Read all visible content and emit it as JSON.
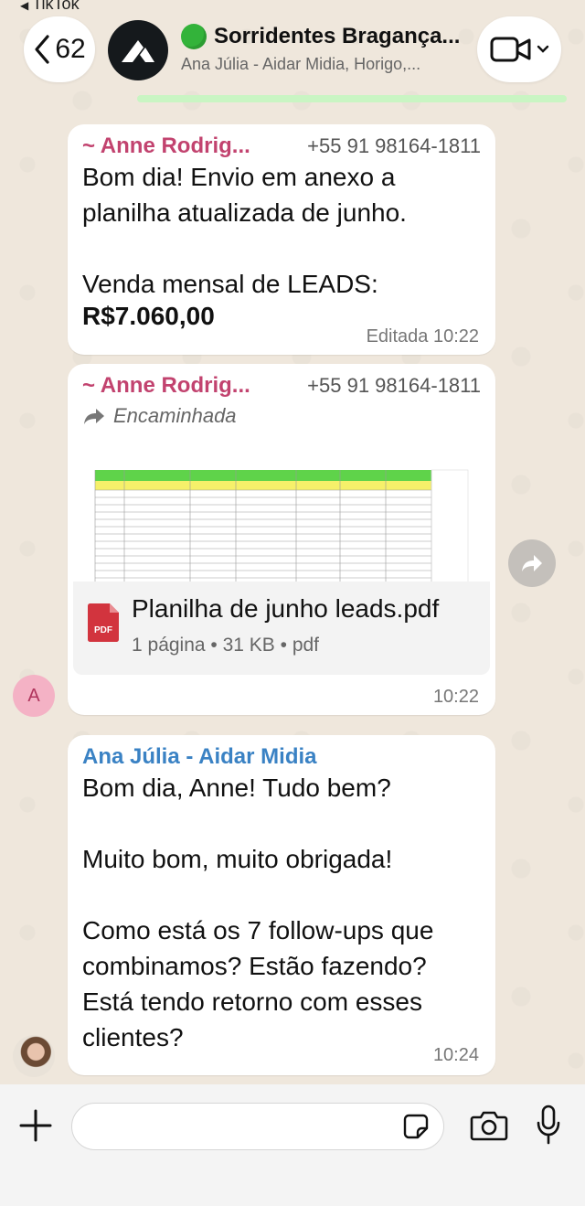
{
  "status": {
    "back_app": "TikTok"
  },
  "header": {
    "back_count": "62",
    "group_name": "Sorridentes Bragança...",
    "participants": "Ana Júlia - Aidar Midia, Horigo,..."
  },
  "messages": [
    {
      "sender": "~ Anne Rodrig...",
      "phone": "+55 91 98164-1811",
      "text": "Bom dia! Envio em anexo a\nplanilha atualizada de junho.\n\nVenda mensal de LEADS:",
      "bold": "R$7.060,00",
      "time": "Editada 10:22"
    },
    {
      "sender": "~ Anne Rodrig...",
      "phone": "+55 91 98164-1811",
      "forwarded": "Encaminhada",
      "file_name": "Planilha de junho leads.pdf",
      "file_icon_label": "PDF",
      "file_meta": "1 página • 31 KB • pdf",
      "avatar_letter": "A",
      "time": "10:22"
    },
    {
      "sender": "Ana Júlia - Aidar Midia",
      "text": "Bom dia, Anne! Tudo bem?\n\nMuito bom, muito obrigada!\n\nComo está os 7 follow-ups que\ncombinamos? Estão fazendo?\nEstá tendo retorno com esses\nclientes?",
      "time": "10:24"
    }
  ],
  "input": {
    "placeholder": ""
  },
  "colors": {
    "accent_green": "#33b33a",
    "sender_pink": "#c2436f",
    "sender_blue": "#3a82c4"
  }
}
